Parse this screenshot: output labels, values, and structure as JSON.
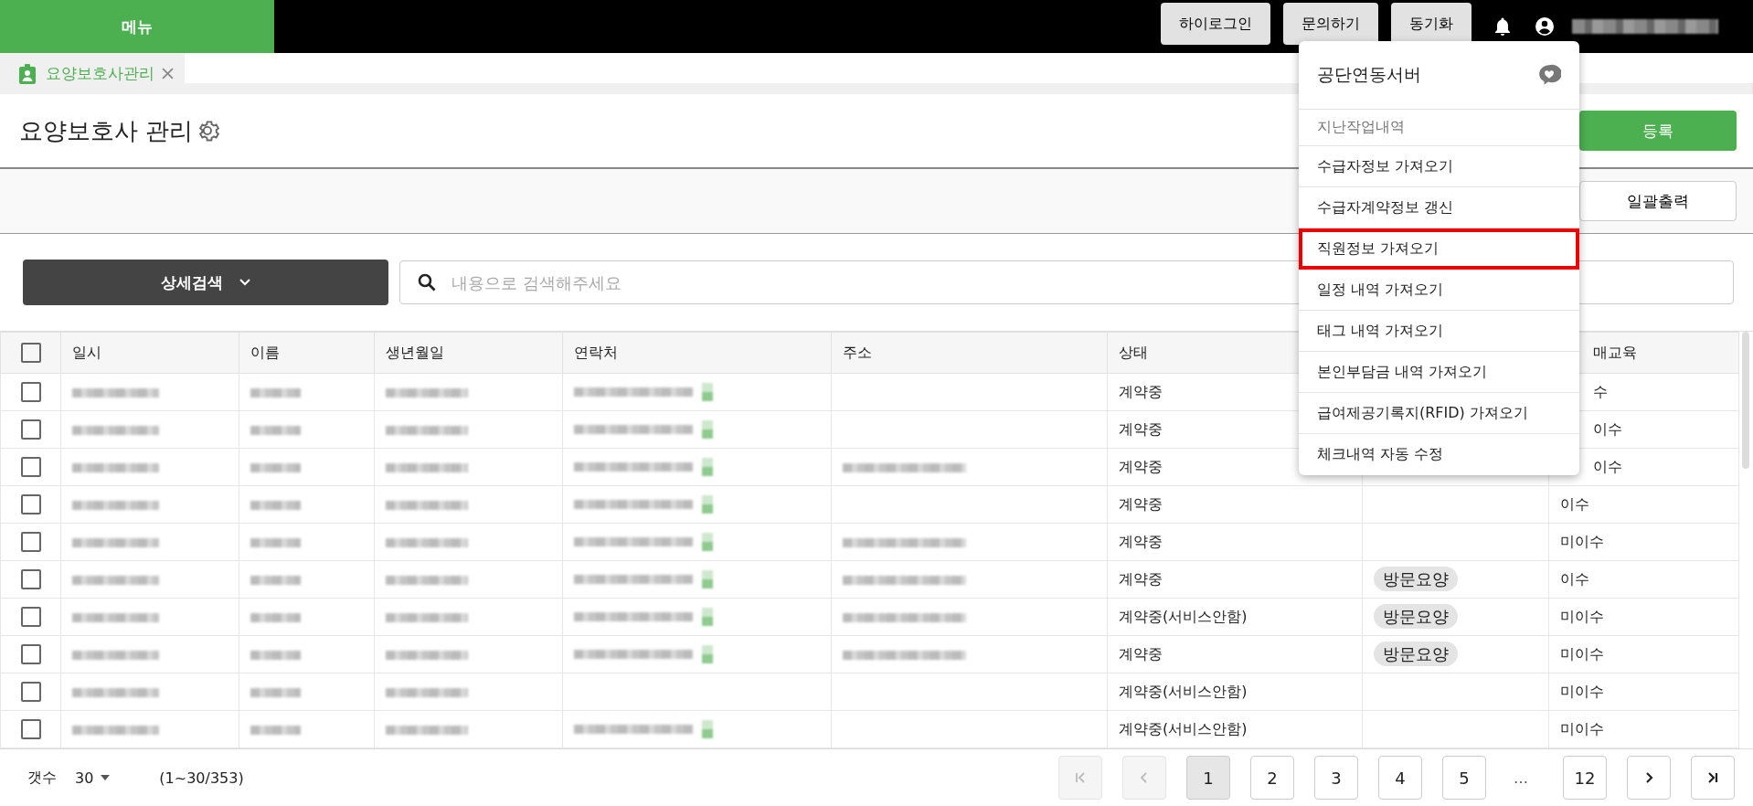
{
  "topbar": {
    "menu": "메뉴",
    "buttons": [
      "하이로그인",
      "문의하기",
      "동기화"
    ]
  },
  "tabs": [
    {
      "label": "요양보호사관리",
      "selected": true
    }
  ],
  "page": {
    "title": "요양보호사 관리",
    "register": "등록",
    "print": "일괄출력"
  },
  "search": {
    "detail": "상세검색",
    "placeholder": "내용으로 검색해주세요"
  },
  "table": {
    "columns": [
      "일시",
      "이름",
      "생년월일",
      "연락처",
      "주소",
      "상태",
      "매교육"
    ],
    "header_checked": false,
    "rows": [
      {
        "checked": false,
        "status": "계약중",
        "tag": "",
        "education": "수",
        "covered": true,
        "contact_shown": true,
        "address_shown": false
      },
      {
        "checked": false,
        "status": "계약중",
        "tag": "",
        "education": "이수",
        "covered": true,
        "contact_shown": true,
        "address_shown": false
      },
      {
        "checked": false,
        "status": "계약중",
        "tag": "",
        "education": "이수",
        "covered": true,
        "contact_shown": true,
        "address_shown": true
      },
      {
        "checked": false,
        "status": "계약중",
        "tag": "",
        "education": "이수",
        "covered": false,
        "contact_shown": true,
        "address_shown": false
      },
      {
        "checked": false,
        "status": "계약중",
        "tag": "",
        "education": "미이수",
        "covered": false,
        "contact_shown": true,
        "address_shown": true
      },
      {
        "checked": false,
        "status": "계약중",
        "tag": "방문요양",
        "education": "이수",
        "covered": false,
        "contact_shown": true,
        "address_shown": true
      },
      {
        "checked": false,
        "status": "계약중(서비스안함)",
        "tag": "방문요양",
        "education": "미이수",
        "covered": false,
        "contact_shown": true,
        "address_shown": true
      },
      {
        "checked": false,
        "status": "계약중",
        "tag": "방문요양",
        "education": "미이수",
        "covered": false,
        "contact_shown": true,
        "address_shown": true
      },
      {
        "checked": false,
        "status": "계약중(서비스안함)",
        "tag": "",
        "education": "미이수",
        "covered": false,
        "contact_shown": false,
        "address_shown": false
      },
      {
        "checked": false,
        "status": "계약중(서비스안함)",
        "tag": "",
        "education": "미이수",
        "covered": false,
        "contact_shown": true,
        "address_shown": false
      }
    ]
  },
  "footer": {
    "count_label": "갯수",
    "page_size": "30",
    "range": "(1~30/353)"
  },
  "pagination": [
    {
      "kind": "first",
      "disabled": true
    },
    {
      "kind": "prev",
      "disabled": true
    },
    {
      "kind": "page",
      "label": "1",
      "disabled": false,
      "selected": true
    },
    {
      "kind": "page",
      "label": "2",
      "disabled": false,
      "selected": false
    },
    {
      "kind": "page",
      "label": "3",
      "disabled": false,
      "selected": false
    },
    {
      "kind": "page",
      "label": "4",
      "disabled": false,
      "selected": false
    },
    {
      "kind": "page",
      "label": "5",
      "disabled": false,
      "selected": false
    },
    {
      "kind": "gap",
      "label": "…"
    },
    {
      "kind": "page",
      "label": "12",
      "disabled": false,
      "selected": false
    },
    {
      "kind": "next",
      "disabled": false
    },
    {
      "kind": "last",
      "disabled": false
    }
  ],
  "dropdown": {
    "title": "공단연동서버",
    "items": [
      {
        "kind": "caption",
        "label": "지난작업내역",
        "highlighted": false
      },
      {
        "kind": "action",
        "label": "수급자정보 가져오기",
        "highlighted": false
      },
      {
        "kind": "action",
        "label": "수급자계약정보 갱신",
        "highlighted": false
      },
      {
        "kind": "action",
        "label": "직원정보 가져오기",
        "highlighted": true
      },
      {
        "kind": "action",
        "label": "일정 내역 가져오기",
        "highlighted": false
      },
      {
        "kind": "action",
        "label": "태그 내역 가져오기",
        "highlighted": false
      },
      {
        "kind": "action",
        "label": "본인부담금 내역 가져오기",
        "highlighted": false
      },
      {
        "kind": "action",
        "label": "급여제공기록지(RFID) 가져오기",
        "highlighted": false
      },
      {
        "kind": "action",
        "label": "체크내역 자동 수정",
        "highlighted": false
      }
    ]
  }
}
